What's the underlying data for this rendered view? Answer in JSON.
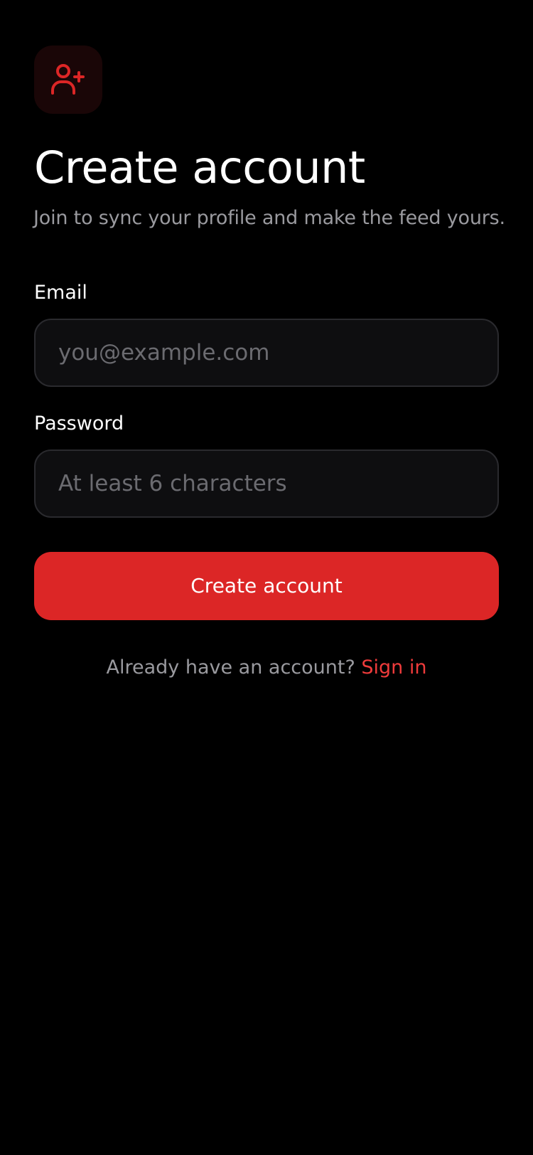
{
  "colors": {
    "background": "#000000",
    "accent": "#dc2626",
    "icon_tile": "#1a0607",
    "muted_text": "#9a9a9f",
    "input_background": "#0e0e10",
    "input_border": "#2a2a2e",
    "link": "#ef3b3b"
  },
  "header": {
    "icon": "user-plus-icon",
    "title": "Create account",
    "subtitle": "Join to sync your profile and make the feed yours."
  },
  "form": {
    "email": {
      "label": "Email",
      "value": "",
      "placeholder": "you@example.com"
    },
    "password": {
      "label": "Password",
      "value": "",
      "placeholder": "At least 6 characters"
    },
    "submit_label": "Create account"
  },
  "footer": {
    "prompt": "Already have an account?",
    "link_label": "Sign in"
  }
}
